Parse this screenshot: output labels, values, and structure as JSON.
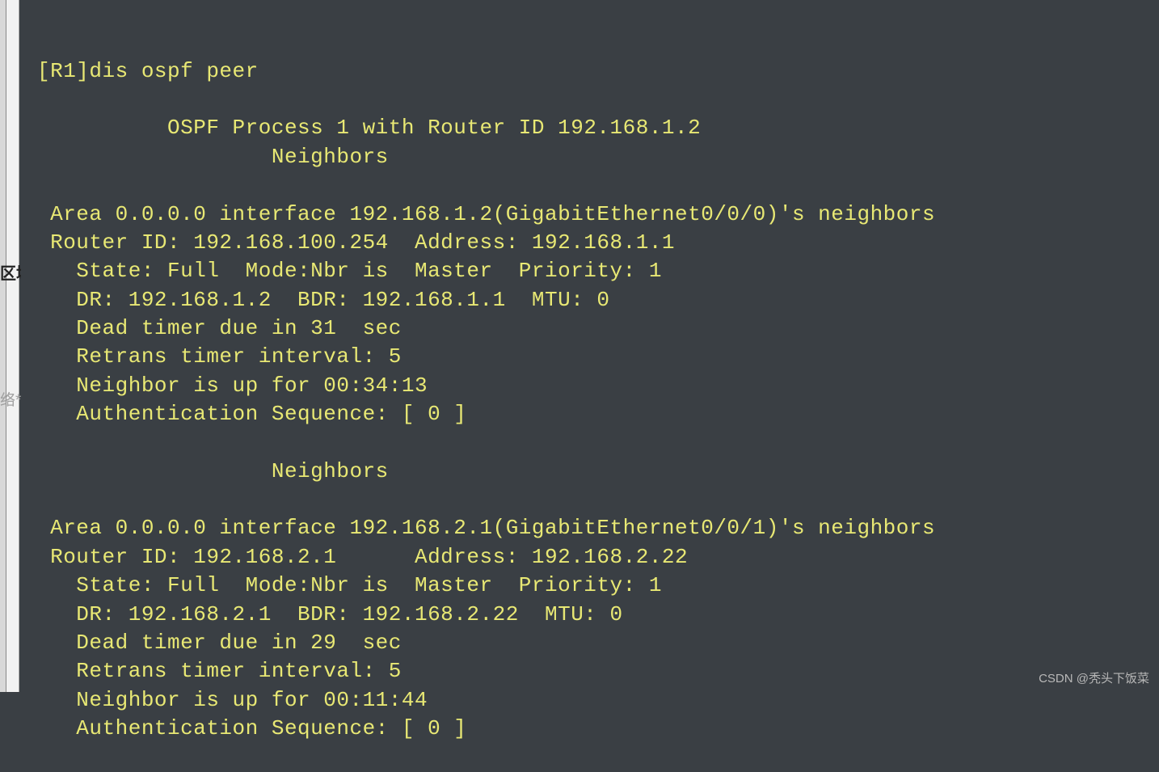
{
  "prompt": "[R1]dis ospf peer",
  "header_process": "\t  OSPF Process 1 with Router ID 192.168.1.2",
  "header_neighbors1": "\t\t  Neighbors ",
  "block1": {
    "area_line": " Area 0.0.0.0 interface 192.168.1.2(GigabitEthernet0/0/0)'s neighbors",
    "router_line": " Router ID: 192.168.100.254  Address: 192.168.1.1  ",
    "state_line": "   State: Full  Mode:Nbr is  Master  Priority: 1",
    "dr_line": "   DR: 192.168.1.2  BDR: 192.168.1.1  MTU: 0    ",
    "dead_line": "   Dead timer due in 31  sec",
    "retrans_line": "   Retrans timer interval: 5 ",
    "uptime_line": "   Neighbor is up for 00:34:13     ",
    "auth_line": "   Authentication Sequence: [ 0 ] "
  },
  "header_neighbors2": "\t\t  Neighbors ",
  "block2": {
    "area_line": " Area 0.0.0.0 interface 192.168.2.1(GigabitEthernet0/0/1)'s neighbors",
    "router_line": " Router ID: 192.168.2.1      Address: 192.168.2.22   ",
    "state_line": "   State: Full  Mode:Nbr is  Master  Priority: 1",
    "dr_line": "   DR: 192.168.2.1  BDR: 192.168.2.22  MTU: 0    ",
    "dead_line": "   Dead timer due in 29  sec",
    "retrans_line": "   Retrans timer interval: 5 ",
    "uptime_line": "   Neighbor is up for 00:11:44     ",
    "auth_line": "   Authentication Sequence: [ 0 ]"
  },
  "behind_label1": "区域ospf",
  "behind_label2": "络**",
  "watermark": "CSDN @秃头下饭菜"
}
